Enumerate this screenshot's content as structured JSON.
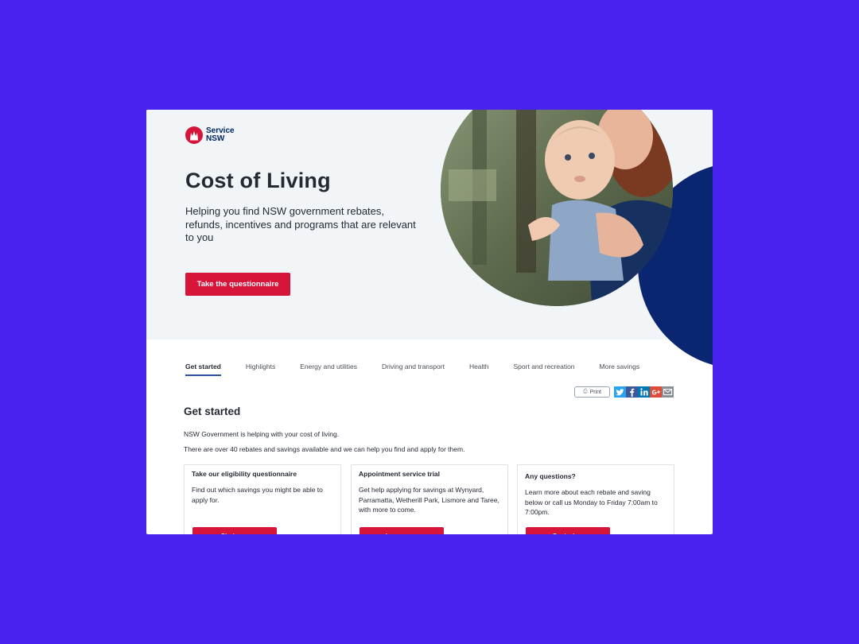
{
  "brand": {
    "line1": "Service",
    "line2": "NSW"
  },
  "hero": {
    "title": "Cost of Living",
    "subtitle": "Helping you find NSW government rebates, refunds, incentives and programs that are relevant to you",
    "cta": "Take the questionnaire"
  },
  "tabs": [
    {
      "label": "Get started",
      "active": true
    },
    {
      "label": "Highlights"
    },
    {
      "label": "Energy and utilities"
    },
    {
      "label": "Driving and transport"
    },
    {
      "label": "Health"
    },
    {
      "label": "Sport and recreation"
    },
    {
      "label": "More savings"
    }
  ],
  "share": {
    "print_label": "Print",
    "icons": [
      "twitter-icon",
      "facebook-icon",
      "linkedin-icon",
      "google-plus-icon",
      "email-icon"
    ]
  },
  "main": {
    "section_title": "Get started",
    "para1": "NSW Government is helping with your cost of living.",
    "para2": "There are over 40 rebates and savings available and we can help you find and apply for them."
  },
  "cards": [
    {
      "title": "Take our eligibility questionnaire",
      "text": "Find out which savings you might be able to apply for.",
      "button": "Start now"
    },
    {
      "title": "Appointment service trial",
      "text": "Get help applying for savings at Wynyard, Parramatta, Wetherill Park, Lismore and Taree, with more to come.",
      "button": "Learn more"
    },
    {
      "title": "Any questions?",
      "text": "Learn more about each rebate and saving below or call us Monday to Friday 7:00am to 7:00pm.",
      "button": "Contact us"
    }
  ],
  "colors": {
    "page_background": "#4a22f0",
    "brand_red": "#d7153a",
    "brand_navy": "#002664",
    "hero_background": "#f2f5f8",
    "tab_underline": "#2e5299"
  }
}
